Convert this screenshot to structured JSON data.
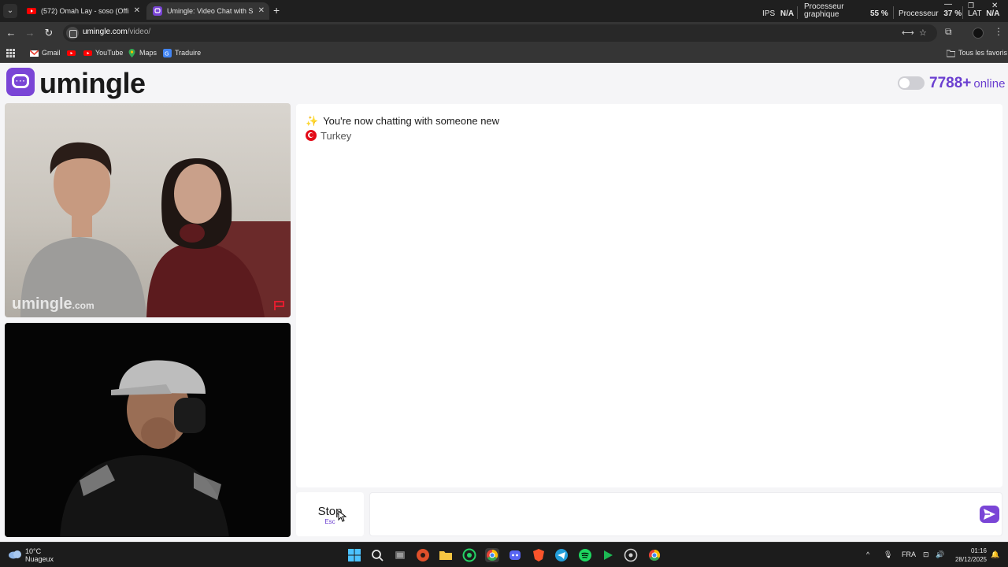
{
  "browser": {
    "tabs": [
      {
        "title": "(572) Omah Lay - soso (Offi",
        "active": false
      },
      {
        "title": "Umingle: Video Chat with S",
        "active": true
      }
    ],
    "new_tab": "+",
    "perf": {
      "ips_label": "IPS",
      "ips_value": "N/A",
      "gpu_label_1": "Processeur",
      "gpu_label_2": "graphique",
      "gpu_value": "55 %",
      "cpu_label": "Processeur",
      "cpu_value": "37 %",
      "lat_label": "LAT",
      "lat_value": "N/A"
    },
    "address": {
      "domain": "umingle.com",
      "path": "/video/"
    },
    "bookmarks": [
      "Gmail",
      "YouTube",
      "Maps",
      "Traduire"
    ],
    "all_bookmarks": "Tous les favoris"
  },
  "site": {
    "logo": "umingle",
    "online_count": "7788+",
    "online_label": "online",
    "watermark_main": "umingle",
    "watermark_suffix": ".com"
  },
  "chat": {
    "system_message": "You're now chatting with someone new",
    "country": "Turkey"
  },
  "controls": {
    "stop_label": "Stop",
    "stop_shortcut": "Esc"
  },
  "taskbar": {
    "temperature": "10°C",
    "weather": "Nuageux",
    "language": "FRA",
    "time": "01:16",
    "date": "28/12/2025"
  },
  "colors": {
    "brand": "#7a45d6",
    "online": "#6b3fd0",
    "turkey_red": "#e30a17"
  }
}
